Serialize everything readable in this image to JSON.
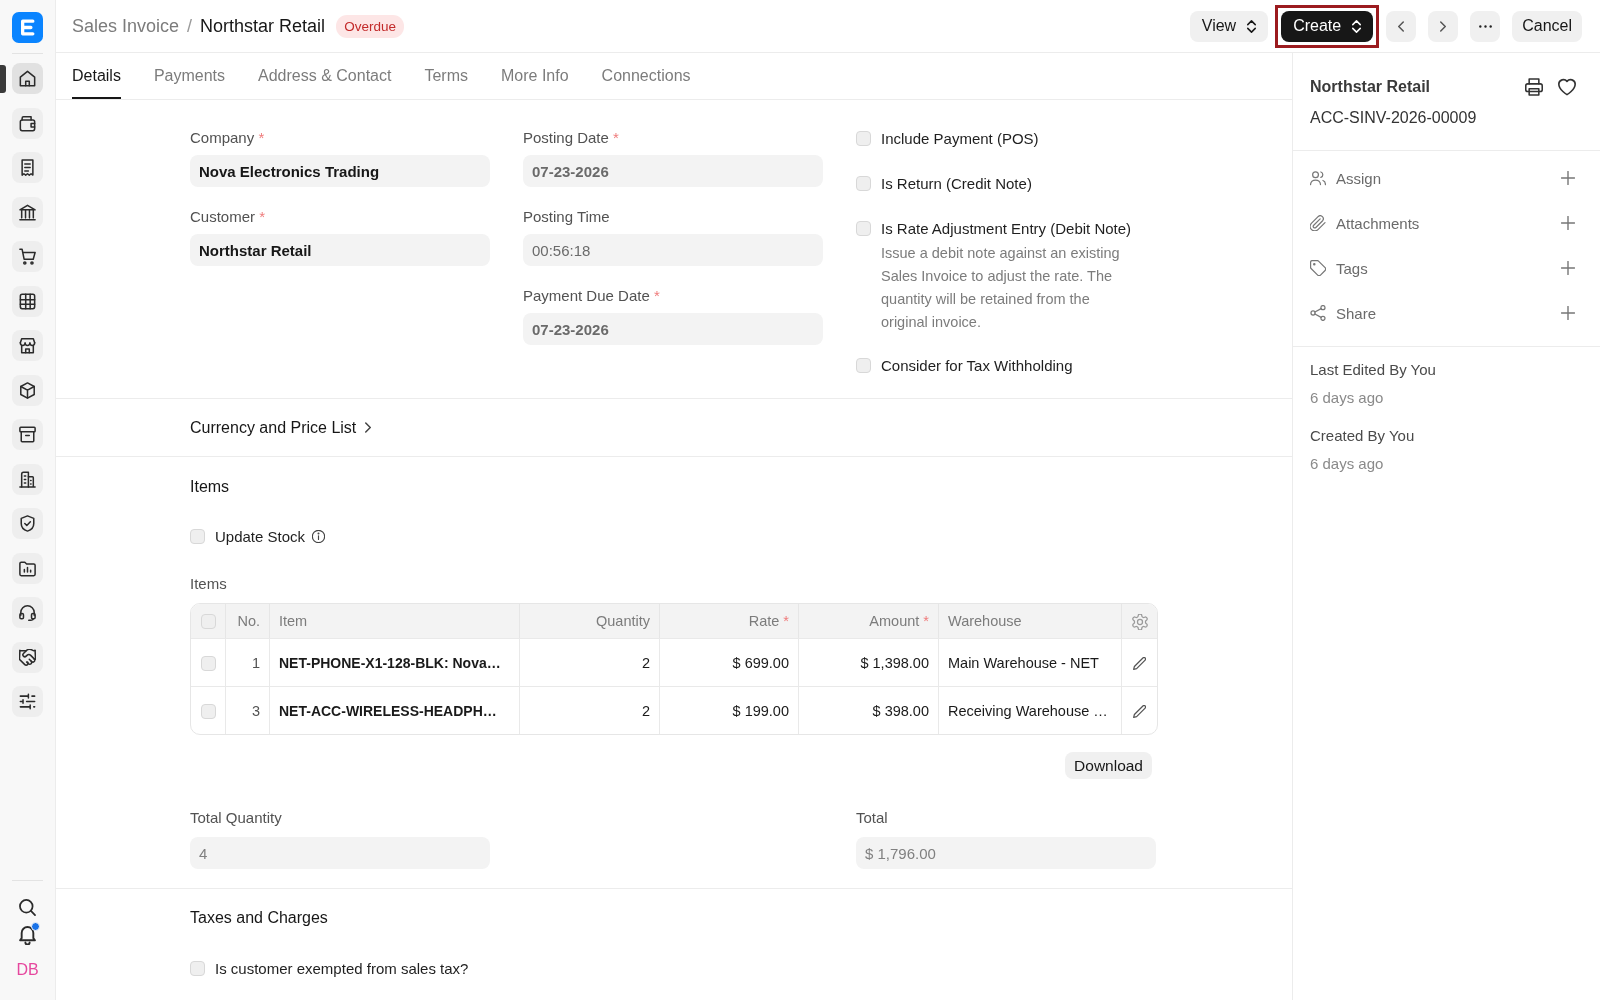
{
  "sidebar": {
    "items": [
      {
        "selected": true
      },
      {
        "selected": false
      },
      {
        "selected": false
      },
      {
        "selected": false
      },
      {
        "selected": false
      },
      {
        "selected": false
      },
      {
        "selected": false
      },
      {
        "selected": false
      },
      {
        "selected": false
      },
      {
        "selected": false
      },
      {
        "selected": false
      },
      {
        "selected": false
      },
      {
        "selected": false
      },
      {
        "selected": false
      },
      {
        "selected": false
      }
    ],
    "notifications": {
      "unread": true
    },
    "user": {
      "initials": "DB"
    }
  },
  "header": {
    "breadcrumb": {
      "parent": "Sales Invoice",
      "separator": "/",
      "current": "Northstar Retail"
    },
    "status": "Overdue",
    "actions": [
      {
        "kind": "dropdown",
        "label": "View",
        "focused": false
      },
      {
        "kind": "primary-dropdown",
        "label": "Create",
        "focused": true
      },
      {
        "kind": "previous",
        "focused": false
      },
      {
        "kind": "next",
        "focused": false
      },
      {
        "kind": "more",
        "focused": false
      },
      {
        "kind": "plain",
        "label": "Cancel",
        "focused": false
      }
    ]
  },
  "tabs": [
    {
      "label": "Details",
      "selected": true
    },
    {
      "label": "Payments",
      "selected": false
    },
    {
      "label": "Address & Contact",
      "selected": false
    },
    {
      "label": "Terms",
      "selected": false
    },
    {
      "label": "More Info",
      "selected": false
    },
    {
      "label": "Connections",
      "selected": false
    }
  ],
  "details": {
    "columns": [
      {
        "fields": [
          {
            "label": "Company",
            "required_mark": "*",
            "value": "Nova Electronics Trading",
            "kind": "link"
          },
          {
            "label": "Customer",
            "required_mark": "*",
            "value": "Northstar Retail",
            "kind": "link"
          }
        ]
      },
      {
        "fields": [
          {
            "label": "Posting Date",
            "required_mark": "*",
            "value": "07-23-2026",
            "kind": "date"
          },
          {
            "label": "Posting Time",
            "value": "00:56:18",
            "kind": "time"
          },
          {
            "label": "Payment Due Date",
            "required_mark": "*",
            "value": "07-23-2026",
            "kind": "date"
          }
        ]
      }
    ],
    "options": [
      {
        "label": "Include Payment (POS)",
        "checked": false
      },
      {
        "label": "Is Return (Credit Note)",
        "checked": false
      },
      {
        "label": "Is Rate Adjustment Entry (Debit Note)",
        "checked": false,
        "description": "Issue a debit note against an existing Sales Invoice to adjust the rate. The quantity will be retained from the original invoice."
      },
      {
        "label": "Consider for Tax Withholding",
        "checked": false
      }
    ]
  },
  "currency_section": {
    "title": "Currency and Price List",
    "expanded": false
  },
  "items_section": {
    "title": "Items",
    "update_stock": {
      "label": "Update Stock",
      "checked": false
    },
    "table": {
      "label": "Items",
      "all_selected": false,
      "columns": [
        {
          "label": "No.",
          "kind": "index"
        },
        {
          "label": "Item",
          "kind": "link"
        },
        {
          "label": "Quantity",
          "kind": "number"
        },
        {
          "label": "Rate",
          "kind": "currency",
          "required_mark": "*"
        },
        {
          "label": "Amount",
          "kind": "currency",
          "required_mark": "*"
        },
        {
          "label": "Warehouse",
          "kind": "text"
        }
      ],
      "rows": [
        {
          "selected": false,
          "cells": [
            "1",
            "NET-PHONE-X1-128-BLK: Nova…",
            "2",
            "$ 699.00",
            "$ 1,398.00",
            "Main Warehouse - NET"
          ]
        },
        {
          "selected": false,
          "cells": [
            "3",
            "NET-ACC-WIRELESS-HEADPH…",
            "2",
            "$ 199.00",
            "$ 398.00",
            "Receiving Warehouse …"
          ]
        }
      ]
    },
    "download": "Download",
    "totals": [
      {
        "label": "Total Quantity",
        "value": "4"
      },
      {
        "label": "Total",
        "value": "$ 1,796.00"
      }
    ]
  },
  "taxes_section": {
    "title": "Taxes and Charges",
    "options": [
      {
        "label": "Is customer exempted from sales tax?",
        "checked": false
      }
    ]
  },
  "side_panel": {
    "title": "Northstar Retail",
    "name": "ACC-SINV-2026-00009",
    "actions": [
      {
        "label": "Assign"
      },
      {
        "label": "Attachments"
      },
      {
        "label": "Tags"
      },
      {
        "label": "Share"
      }
    ],
    "activity": [
      {
        "label": "Last Edited By You",
        "time": "6 days ago"
      },
      {
        "label": "Created By You",
        "time": "6 days ago"
      }
    ]
  }
}
